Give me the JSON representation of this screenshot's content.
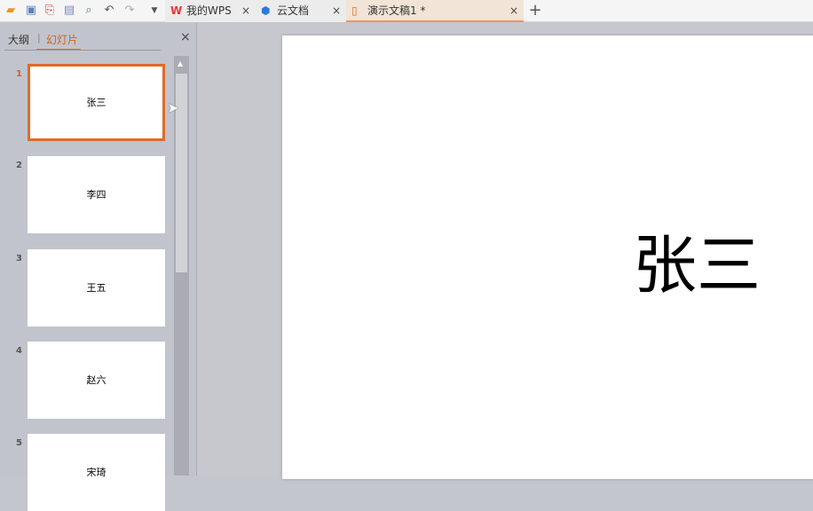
{
  "toolbar": {
    "icons": [
      "open-icon",
      "save-icon",
      "export-pdf-icon",
      "print-icon",
      "print-preview-icon",
      "undo-icon",
      "redo-icon",
      "dropdown-icon"
    ]
  },
  "tabs": [
    {
      "label": "我的WPS",
      "icon": "wps-logo-icon",
      "active": false
    },
    {
      "label": "云文档",
      "icon": "cloud-doc-icon",
      "active": false
    },
    {
      "label": "演示文稿1 *",
      "icon": "presentation-icon",
      "active": true
    }
  ],
  "new_tab": "+",
  "panel": {
    "tabs": [
      "大纲",
      "幻灯片"
    ],
    "active_tab": "幻灯片",
    "close": "×"
  },
  "slides": [
    {
      "number": "1",
      "text": "张三",
      "selected": true
    },
    {
      "number": "2",
      "text": "李四"
    },
    {
      "number": "3",
      "text": "王五"
    },
    {
      "number": "4",
      "text": "赵六"
    },
    {
      "number": "5",
      "text": "宋琦"
    }
  ],
  "current_slide": {
    "title": "张三"
  },
  "colors": {
    "accent": "#e06a27"
  }
}
